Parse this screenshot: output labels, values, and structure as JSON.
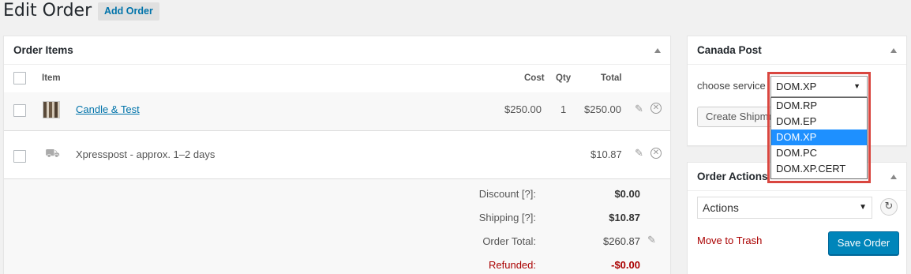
{
  "header": {
    "title": "Edit Order",
    "add_button": "Add Order"
  },
  "order_items": {
    "title": "Order Items",
    "columns": {
      "item": "Item",
      "cost": "Cost",
      "qty": "Qty",
      "total": "Total"
    },
    "items": [
      {
        "name": "Candle & Test",
        "cost": "$250.00",
        "qty": "1",
        "total": "$250.00"
      }
    ],
    "shipping": {
      "name": "Xpresspost - approx. 1–2 days",
      "total": "$10.87"
    },
    "totals": [
      {
        "label": "Discount [?]:",
        "value": "$0.00"
      },
      {
        "label": "Shipping [?]:",
        "value": "$10.87"
      },
      {
        "label": "Order Total:",
        "value": "$260.87"
      },
      {
        "label": "Refunded:",
        "value": "-$0.00"
      }
    ]
  },
  "canada_post": {
    "title": "Canada Post",
    "choose_label": "choose service",
    "create_button": "Create Shipment",
    "service_select": {
      "selected": "DOM.XP",
      "options": [
        "DOM.RP",
        "DOM.EP",
        "DOM.XP",
        "DOM.PC",
        "DOM.XP.CERT"
      ]
    }
  },
  "order_actions": {
    "title": "Order Actions",
    "select_value": "Actions",
    "trash_link": "Move to Trash",
    "save_button": "Save Order"
  },
  "colors": {
    "accent": "#0085ba",
    "link": "#0073aa",
    "danger": "#a00000",
    "highlight_frame": "#d9463f",
    "selected_option": "#1e90ff"
  }
}
